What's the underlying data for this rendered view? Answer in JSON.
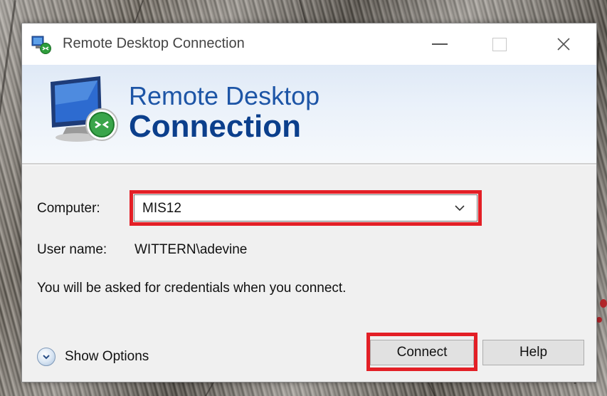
{
  "window": {
    "title": "Remote Desktop Connection",
    "controls": {
      "minimize": "minimize",
      "maximize": "maximize",
      "close": "close"
    }
  },
  "banner": {
    "line1": "Remote Desktop",
    "line2": "Connection"
  },
  "form": {
    "computer_label": "Computer:",
    "computer_value": "MIS12",
    "user_label": "User name:",
    "user_value": "WITTERN\\adevine",
    "info": "You will be asked for credentials when you connect."
  },
  "footer": {
    "show_options": "Show Options",
    "connect": "Connect",
    "help": "Help"
  },
  "icons": {
    "title": "remote-desktop-icon",
    "banner": "monitor-connection-icon",
    "dropdown": "chevron-down-icon",
    "options": "expand-circle-icon"
  },
  "colors": {
    "highlight": "#e31f26",
    "banner_text": "#0b3f8c",
    "accent": "#1d55a6"
  }
}
